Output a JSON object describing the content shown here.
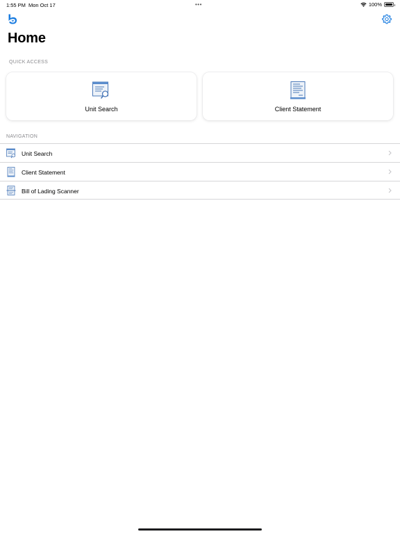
{
  "status_bar": {
    "time": "1:55 PM",
    "date": "Mon Oct 17",
    "dots": "•••",
    "battery_text": "100%",
    "battery_level_percent": 100
  },
  "nav_bar": {
    "logo_icon": "app-logo-icon",
    "settings_icon": "gear-icon",
    "accent_color": "#1a7ce0"
  },
  "page": {
    "title": "Home"
  },
  "quick_access": {
    "header": "QUICK ACCESS",
    "cards": [
      {
        "label": "Unit Search",
        "icon": "unit-search-icon"
      },
      {
        "label": "Client Statement",
        "icon": "client-statement-icon"
      }
    ]
  },
  "navigation": {
    "header": "NAVIGATION",
    "items": [
      {
        "label": "Unit Search",
        "icon": "unit-search-icon"
      },
      {
        "label": "Client Statement",
        "icon": "client-statement-icon"
      },
      {
        "label": "Bill of Lading Scanner",
        "icon": "bill-of-lading-scanner-icon"
      }
    ]
  }
}
